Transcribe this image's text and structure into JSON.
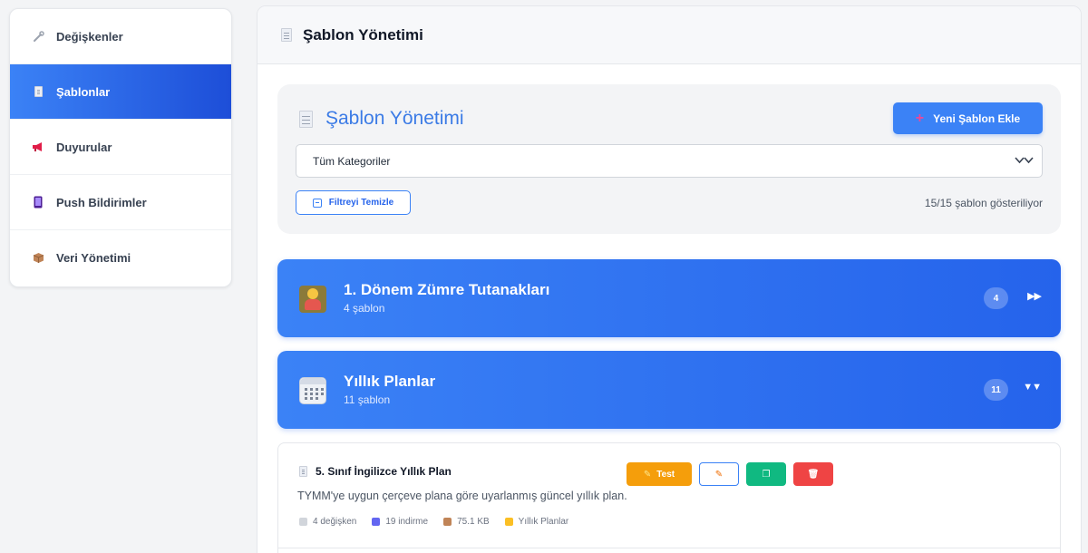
{
  "sidebar": {
    "items": [
      {
        "label": "Değişkenler",
        "icon": "wrench-icon",
        "active": false
      },
      {
        "label": "Şablonlar",
        "icon": "document-icon",
        "active": true
      },
      {
        "label": "Duyurular",
        "icon": "megaphone-icon",
        "active": false
      },
      {
        "label": "Push Bildirimler",
        "icon": "phone-icon",
        "active": false
      },
      {
        "label": "Veri Yönetimi",
        "icon": "package-icon",
        "active": false
      }
    ]
  },
  "header": {
    "title": "Şablon Yönetimi"
  },
  "templates": {
    "title": "Şablon Yönetimi",
    "add_button": "Yeni Şablon Ekle",
    "category_select": "Tüm Kategoriler",
    "clear_filter": "Filtreyi Temizle",
    "count_text": "15/15 şablon gösteriliyor"
  },
  "categories": [
    {
      "name": "1. Dönem Zümre Tutanakları",
      "sub": "4 şablon",
      "count": "4",
      "arrow": "▶▶",
      "icon": "person-icon"
    },
    {
      "name": "Yıllık Planlar",
      "sub": "11 şablon",
      "count": "11",
      "arrow": "▼▼",
      "icon": "calendar-icon"
    }
  ],
  "template_item": {
    "title": "5. Sınıf İngilizce Yıllık Plan",
    "description": "TYMM'ye uygun çerçeve plana göre uyarlanmış güncel yıllık plan.",
    "meta": {
      "variables": "4 değişken",
      "downloads": "19 indirme",
      "size": "75.1 KB",
      "category": "Yıllık Planlar"
    },
    "actions": {
      "test": "Test",
      "edit_icon": "✎",
      "copy_icon": "❐",
      "delete_icon": "🗑"
    }
  },
  "colors": {
    "accent": "#3b82f6",
    "accent_dark": "#1d4ed8",
    "warning": "#f59e0b",
    "success": "#10b981",
    "danger": "#ef4444"
  }
}
